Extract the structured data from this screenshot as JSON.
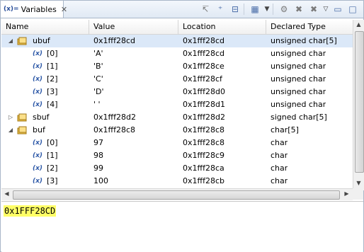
{
  "view": {
    "title": "Variables",
    "columns": [
      "Name",
      "Value",
      "Location",
      "Declared Type"
    ]
  },
  "rows": [
    {
      "name": "ubuf",
      "value": "0x1fff28cd",
      "location": "0x1fff28cd",
      "type": "unsigned char[5]"
    },
    {
      "name": "[0]",
      "value": "'A'",
      "location": "0x1fff28cd",
      "type": "unsigned char"
    },
    {
      "name": "[1]",
      "value": "'B'",
      "location": "0x1fff28ce",
      "type": "unsigned char"
    },
    {
      "name": "[2]",
      "value": "'C'",
      "location": "0x1fff28cf",
      "type": "unsigned char"
    },
    {
      "name": "[3]",
      "value": "'D'",
      "location": "0x1fff28d0",
      "type": "unsigned char"
    },
    {
      "name": "[4]",
      "value": "' '",
      "location": "0x1fff28d1",
      "type": "unsigned char"
    },
    {
      "name": "sbuf",
      "value": "0x1fff28d2",
      "location": "0x1fff28d2",
      "type": "signed char[5]"
    },
    {
      "name": "buf",
      "value": "0x1fff28c8",
      "location": "0x1fff28c8",
      "type": "char[5]"
    },
    {
      "name": "[0]",
      "value": "97",
      "location": "0x1fff28c8",
      "type": "char"
    },
    {
      "name": "[1]",
      "value": "98",
      "location": "0x1fff28c9",
      "type": "char"
    },
    {
      "name": "[2]",
      "value": "99",
      "location": "0x1fff28ca",
      "type": "char"
    },
    {
      "name": "[3]",
      "value": "100",
      "location": "0x1fff28cb",
      "type": "char"
    }
  ],
  "detail": {
    "value": "0x1FFF28CD"
  },
  "icons": {
    "variable_icon": "(x)=",
    "element_icon": "(x)",
    "struct_icon_color": "#f0c040"
  },
  "colors": {
    "selection": "#dbe8f8",
    "highlight": "#ffff66"
  }
}
